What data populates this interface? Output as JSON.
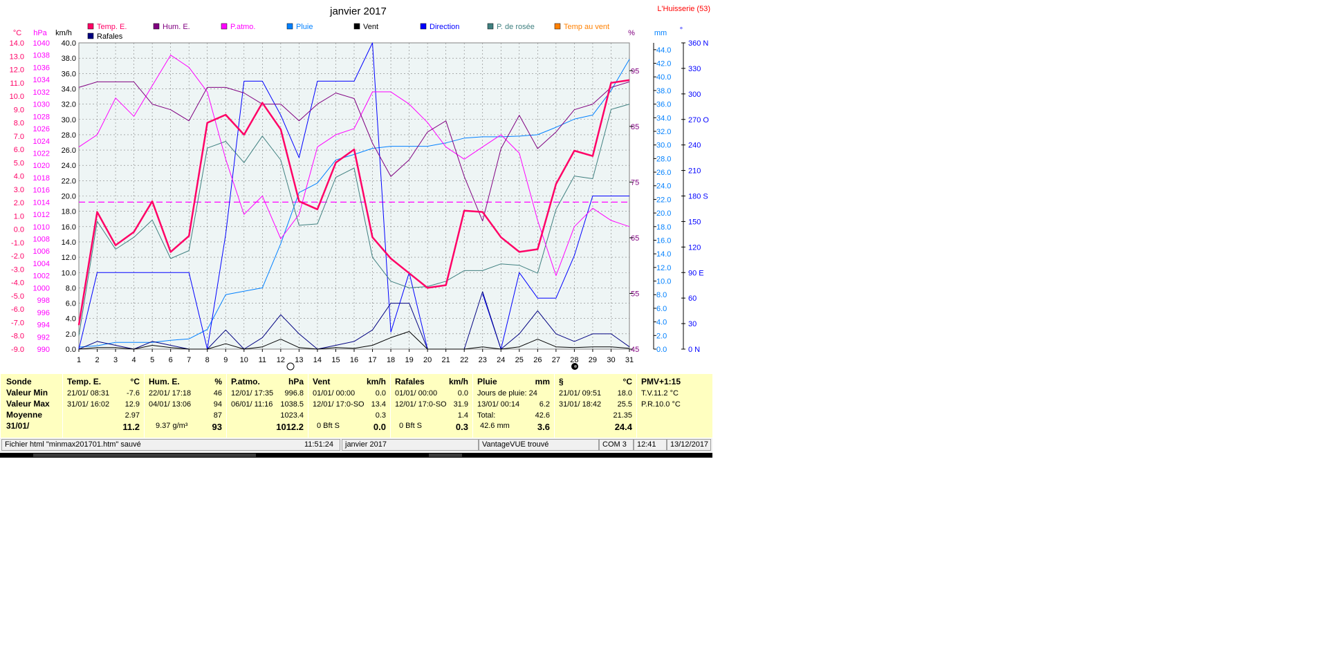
{
  "window": {
    "title": "janvier 2017",
    "location": "L'Huisserie (53)"
  },
  "axis_units": {
    "temp": "°C",
    "press": "hPa",
    "wind": "km/h",
    "hum": "%",
    "rain": "mm",
    "dir": "°"
  },
  "colors": {
    "temp": "#ff0066",
    "hum": "#800080",
    "patmo": "#ff00ff",
    "pluie": "#0080ff",
    "vent": "#000000",
    "direction": "#0000ff",
    "rosee": "#408080",
    "tempvent": "#ff8000",
    "rafales": "#000080"
  },
  "chart_data": {
    "type": "line",
    "title": "janvier 2017",
    "x": [
      1,
      2,
      3,
      4,
      5,
      6,
      7,
      8,
      9,
      10,
      11,
      12,
      13,
      14,
      15,
      16,
      17,
      18,
      19,
      20,
      21,
      22,
      23,
      24,
      25,
      26,
      27,
      28,
      29,
      30,
      31
    ],
    "axes": {
      "temp": {
        "min": -9,
        "max": 14,
        "step": 1,
        "ticks": [
          "14.0",
          "13.0",
          "12.0",
          "11.0",
          "10.0",
          "9.0",
          "8.0",
          "7.0",
          "6.0",
          "5.0",
          "4.0",
          "3.0",
          "2.0",
          "1.0",
          "0.0",
          "-1.0",
          "-2.0",
          "-3.0",
          "-4.0",
          "-5.0",
          "-6.0",
          "-7.0",
          "-8.0",
          "-9.0"
        ]
      },
      "press": {
        "min": 990,
        "max": 1040,
        "step": 2,
        "ticks": [
          "1040",
          "1038",
          "1036",
          "1034",
          "1032",
          "1030",
          "1028",
          "1026",
          "1024",
          "1022",
          "1020",
          "1018",
          "1016",
          "1014",
          "1012",
          "1010",
          "1008",
          "1006",
          "1004",
          "1002",
          "1000",
          "998",
          "996",
          "994",
          "992",
          "990"
        ]
      },
      "wind": {
        "min": 0,
        "max": 40,
        "step": 2,
        "ticks": [
          "40.0",
          "38.0",
          "36.0",
          "34.0",
          "32.0",
          "30.0",
          "28.0",
          "26.0",
          "24.0",
          "22.0",
          "20.0",
          "18.0",
          "16.0",
          "14.0",
          "12.0",
          "10.0",
          "8.0",
          "6.0",
          "4.0",
          "2.0",
          "0.0"
        ]
      },
      "hum": {
        "min": 45,
        "max": 100,
        "ticks": [
          "95",
          "85",
          "75",
          "65",
          "55",
          "45"
        ]
      },
      "rain": {
        "min": 0,
        "max": 45,
        "step": 2,
        "ticks": [
          "44.0",
          "42.0",
          "40.0",
          "38.0",
          "36.0",
          "34.0",
          "32.0",
          "30.0",
          "28.0",
          "26.0",
          "24.0",
          "22.0",
          "20.0",
          "18.0",
          "16.0",
          "14.0",
          "12.0",
          "10.0",
          "8.0",
          "6.0",
          "4.0",
          "2.0",
          "0.0"
        ]
      },
      "dir": {
        "min": 0,
        "max": 360,
        "ticks": [
          {
            "v": 360,
            "t": "360 N"
          },
          {
            "v": 330,
            "t": "330"
          },
          {
            "v": 300,
            "t": "300"
          },
          {
            "v": 270,
            "t": "270 O"
          },
          {
            "v": 240,
            "t": "240"
          },
          {
            "v": 210,
            "t": "210"
          },
          {
            "v": 180,
            "t": "180 S"
          },
          {
            "v": 150,
            "t": "150"
          },
          {
            "v": 120,
            "t": "120"
          },
          {
            "v": 90,
            "t": "90  E"
          },
          {
            "v": 60,
            "t": "60"
          },
          {
            "v": 30,
            "t": "30"
          },
          {
            "v": 0,
            "t": "0    N"
          }
        ]
      }
    },
    "series": [
      {
        "key": "temp",
        "name": "Temp. E.",
        "axis": "temp",
        "width": 2.5,
        "values": [
          -7.2,
          1.3,
          -1.2,
          -0.2,
          2.1,
          -1.7,
          -0.5,
          8.0,
          8.6,
          7.1,
          9.5,
          7.5,
          2.1,
          1.5,
          5.0,
          6.0,
          -0.6,
          -2.2,
          -3.3,
          -4.4,
          -4.2,
          1.4,
          1.3,
          -0.6,
          -1.7,
          -1.5,
          3.4,
          5.9,
          5.5,
          11.0,
          11.2
        ]
      },
      {
        "key": "hum",
        "name": "Hum. E.",
        "axis": "hum",
        "width": 1,
        "values": [
          92,
          93,
          93,
          93,
          89,
          88,
          86,
          92,
          92,
          91,
          89,
          89,
          86,
          89,
          91,
          90,
          82,
          76,
          79,
          84,
          86,
          76,
          68,
          81,
          87,
          81,
          84,
          88,
          89,
          92,
          93
        ]
      },
      {
        "key": "patmo",
        "name": "P.atmo.",
        "axis": "press",
        "width": 1,
        "values": [
          1023,
          1025,
          1031,
          1028,
          1033,
          1038,
          1036,
          1032,
          1021,
          1012,
          1015,
          1008,
          1012,
          1023,
          1025,
          1026,
          1032,
          1032,
          1030,
          1027,
          1023,
          1021,
          1023,
          1025,
          1022,
          1011,
          1002,
          1010,
          1013,
          1011,
          1010
        ]
      },
      {
        "key": "pluie",
        "name": "Pluie",
        "axis": "rain",
        "width": 1,
        "values": [
          0.3,
          0.5,
          1.0,
          1.0,
          1.0,
          1.3,
          1.5,
          2.9,
          8.0,
          8.5,
          9.0,
          15.5,
          23.0,
          24.4,
          27.8,
          28.6,
          29.5,
          29.8,
          29.8,
          29.8,
          30.3,
          31.0,
          31.2,
          31.2,
          31.3,
          31.5,
          32.6,
          33.8,
          34.4,
          38.0,
          42.6
        ]
      },
      {
        "key": "vent",
        "name": "Vent",
        "axis": "wind",
        "width": 1,
        "values": [
          0.0,
          0.2,
          0.2,
          0.0,
          0.5,
          0.2,
          0.0,
          0.0,
          0.7,
          0.0,
          0.3,
          1.3,
          0.2,
          0.0,
          0.2,
          0.1,
          0.5,
          1.5,
          2.3,
          0.0,
          0.0,
          0.0,
          0.3,
          0.0,
          0.3,
          1.3,
          0.3,
          0.2,
          0.3,
          0.3,
          0.1
        ]
      },
      {
        "key": "direction",
        "name": "Direction",
        "axis": "dir",
        "width": 1,
        "values": [
          0,
          90,
          90,
          90,
          90,
          90,
          90,
          0,
          135,
          315,
          315,
          275,
          225,
          315,
          315,
          315,
          360,
          20,
          90,
          0,
          null,
          null,
          65,
          0,
          90,
          60,
          60,
          110,
          180,
          180,
          180
        ]
      },
      {
        "key": "rosee",
        "name": "P. de rosée",
        "axis": "temp",
        "width": 1,
        "values": [
          -8.0,
          0.6,
          -1.5,
          -0.6,
          0.7,
          -2.2,
          -1.6,
          6.1,
          6.6,
          5.0,
          7.0,
          5.2,
          0.3,
          0.4,
          3.9,
          4.6,
          -2.1,
          -3.9,
          -4.4,
          -4.3,
          -3.9,
          -3.1,
          -3.1,
          -2.6,
          -2.7,
          -3.3,
          1.5,
          4.0,
          3.8,
          9.0,
          9.4
        ]
      },
      {
        "key": "rafales",
        "name": "Rafales",
        "axis": "wind",
        "width": 1,
        "values": [
          0.0,
          1.0,
          0.5,
          0.0,
          1.0,
          0.5,
          0.0,
          0.0,
          2.5,
          0.0,
          1.5,
          4.5,
          2.0,
          0.0,
          0.5,
          1.0,
          2.5,
          6.0,
          6.0,
          0.0,
          0.0,
          0.0,
          7.5,
          0.0,
          2.0,
          5.0,
          2.0,
          1.0,
          2.0,
          2.0,
          0.3
        ]
      }
    ],
    "legend": [
      {
        "key": "temp",
        "name": "Temp. E."
      },
      {
        "key": "hum",
        "name": "Hum. E."
      },
      {
        "key": "patmo",
        "name": "P.atmo."
      },
      {
        "key": "pluie",
        "name": "Pluie"
      },
      {
        "key": "vent",
        "name": "Vent"
      },
      {
        "key": "direction",
        "name": "Direction"
      },
      {
        "key": "rosee",
        "name": "P. de rosée"
      },
      {
        "key": "tempvent",
        "name": "Temp au vent"
      },
      {
        "key": "rafales",
        "name": "Rafales"
      }
    ],
    "reference_line": {
      "axis": "press",
      "value": 1014,
      "color": "#ff00ff"
    },
    "grid": true
  },
  "stats": {
    "sonde": {
      "title": "Sonde",
      "rows": [
        "Valeur Min",
        "Valeur Max",
        "Moyenne",
        "31/01/"
      ]
    },
    "temp": {
      "title": "Temp. E.",
      "unit": "°C",
      "min_date": "21/01/  08:31",
      "min_val": "-7.6",
      "max_date": "31/01/  16:02",
      "max_val": "12.9",
      "avg": "2.97",
      "last": "11.2"
    },
    "hum": {
      "title": "Hum. E.",
      "unit": "%",
      "min_date": "22/01/  17:18",
      "min_val": "46",
      "max_date": "04/01/  13:06",
      "max_val": "94",
      "avg": "87",
      "extra": "9.37 g/m³",
      "last": "93"
    },
    "press": {
      "title": "P.atmo.",
      "unit": "hPa",
      "min_date": "12/01/  17:35",
      "min_val": "996.8",
      "max_date": "06/01/  11:16",
      "max_val": "1038.5",
      "avg": "1023.4",
      "last": "1012.2"
    },
    "vent": {
      "title": "Vent",
      "unit": "km/h",
      "min_date": "01/01/  00:00",
      "min_val": "0.0",
      "max_date": "12/01/  17:0-SO",
      "max_val": "13.4",
      "avg": "0.3",
      "extra": "0 Bft S",
      "last": "0.0"
    },
    "rafales": {
      "title": "Rafales",
      "unit": "km/h",
      "min_date": "01/01/  00:00",
      "min_val": "0.0",
      "max_date": "12/01/  17:0-SO",
      "max_val": "31.9",
      "avg": "1.4",
      "extra": "0 Bft S",
      "last": "0.3"
    },
    "pluie": {
      "title": "Pluie",
      "unit": "mm",
      "r1": "Jours de pluie: 24",
      "r2_date": "13/01/  00:14",
      "r2_val": "6.2",
      "r3_l": "Total:",
      "r3_val": "42.6",
      "extra": "42.6 mm",
      "last": "3.6"
    },
    "s": {
      "title": "§",
      "unit": "°C",
      "min_date": "21/01/  09:51",
      "min_val": "18.0",
      "max_date": "31/01/  18:42",
      "max_val": "25.5",
      "avg": "21.35",
      "last": "24.4"
    },
    "pmv": {
      "title": "PMV+1:15",
      "r1": "T.V.11.2 °C",
      "r2": "P.R.10.0 °C"
    }
  },
  "statusbar": {
    "file": "Fichier html  \"minmax201701.htm\"  sauvé",
    "time": "11:51:24",
    "month": "janvier 2017",
    "device": "VantageVUE trouvé",
    "port": "COM 3",
    "clock": "12:41",
    "date": "13/12/2017"
  }
}
